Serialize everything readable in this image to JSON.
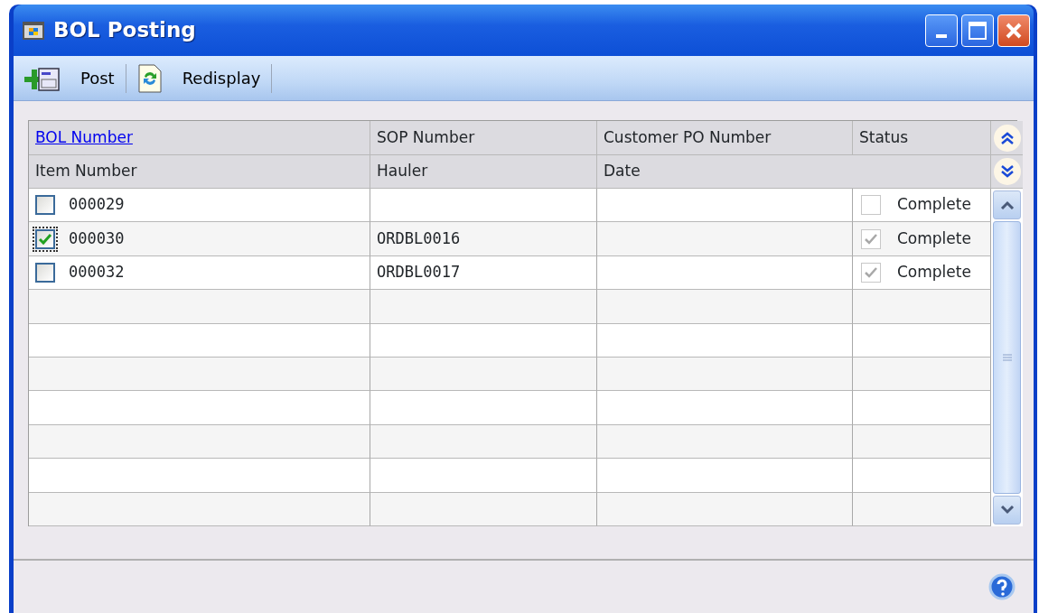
{
  "window": {
    "title": "BOL Posting"
  },
  "toolbar": [
    {
      "kind": "post",
      "label": "Post"
    },
    {
      "kind": "redisplay",
      "label": "Redisplay"
    }
  ],
  "grid": {
    "header_row_1": [
      {
        "label": "BOL Number",
        "kind": "link"
      },
      {
        "label": "SOP Number",
        "kind": "text"
      },
      {
        "label": "Customer PO Number",
        "kind": "text"
      },
      {
        "label": "Status",
        "kind": "text"
      }
    ],
    "header_row_2": [
      {
        "label": "Item Number"
      },
      {
        "label": "Hauler"
      },
      {
        "label": "Date"
      }
    ],
    "rows": [
      {
        "checked": false,
        "focused": false,
        "bol_number": "000029",
        "sop_number": "",
        "status_checked": false,
        "status": "Complete"
      },
      {
        "checked": true,
        "focused": true,
        "bol_number": "000030",
        "sop_number": "ORDBL0016",
        "status_checked": true,
        "status": "Complete"
      },
      {
        "checked": false,
        "focused": false,
        "bol_number": "000032",
        "sop_number": "ORDBL0017",
        "status_checked": true,
        "status": "Complete"
      }
    ]
  }
}
